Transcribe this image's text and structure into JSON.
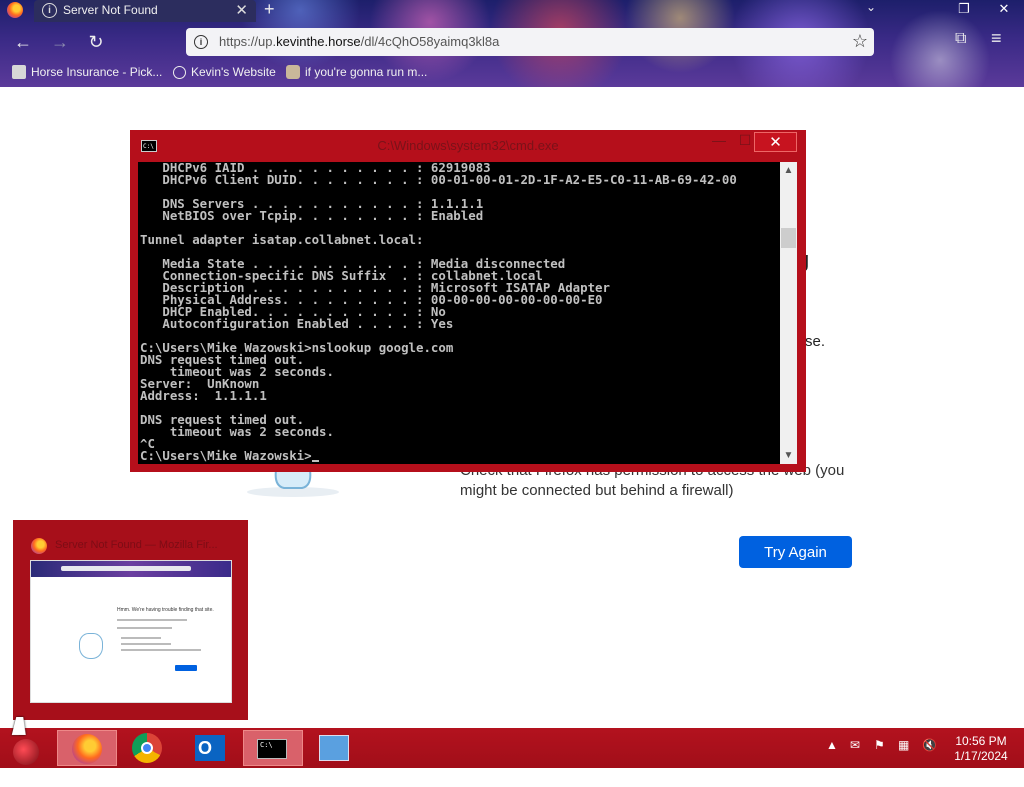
{
  "browser": {
    "tab_title": "Server Not Found",
    "tab_close": "✕",
    "new_tab": "+",
    "url_host_prefix": "https://up.",
    "url_host": "kevinthe.horse",
    "url_path": "/dl/4cQhO58yaimq3kl8a",
    "bookmarks": [
      {
        "label": "Horse Insurance - Pick..."
      },
      {
        "label": "Kevin's Website"
      },
      {
        "label": "if you're gonna run m..."
      }
    ]
  },
  "page": {
    "heading_fragment": "g",
    "text_fragment": "se.",
    "firewall_tip": "Check that Firefox has permission to access the web (you might be connected but behind a firewall)",
    "try_again_label": "Try Again"
  },
  "cmd": {
    "title": "C:\\Windows\\system32\\cmd.exe",
    "lines": [
      "   DHCPv6 IAID . . . . . . . . . . . : 62919083",
      "   DHCPv6 Client DUID. . . . . . . . : 00-01-00-01-2D-1F-A2-E5-C0-11-AB-69-42-00",
      "",
      "   DNS Servers . . . . . . . . . . . : 1.1.1.1",
      "   NetBIOS over Tcpip. . . . . . . . : Enabled",
      "",
      "Tunnel adapter isatap.collabnet.local:",
      "",
      "   Media State . . . . . . . . . . . : Media disconnected",
      "   Connection-specific DNS Suffix  . : collabnet.local",
      "   Description . . . . . . . . . . . : Microsoft ISATAP Adapter",
      "   Physical Address. . . . . . . . . : 00-00-00-00-00-00-00-E0",
      "   DHCP Enabled. . . . . . . . . . . : No",
      "   Autoconfiguration Enabled . . . . : Yes",
      "",
      "C:\\Users\\Mike Wazowski>nslookup google.com",
      "DNS request timed out.",
      "    timeout was 2 seconds.",
      "Server:  UnKnown",
      "Address:  1.1.1.1",
      "",
      "DNS request timed out.",
      "    timeout was 2 seconds.",
      "^C"
    ],
    "prompt": "C:\\Users\\Mike Wazowski>"
  },
  "thumbnail": {
    "title": "Server Not Found — Mozilla Fir...",
    "mini_heading": "Hmm. We're having trouble finding that site."
  },
  "taskbar": {
    "apps": [
      "firefox-icon",
      "chrome-icon",
      "outlook-icon",
      "cmd-icon",
      "control-panel-icon"
    ],
    "clock_time": "10:56 PM",
    "clock_date": "1/17/2024"
  },
  "colors": {
    "taskbar": "#b3121e",
    "cmd_frame": "#b50f1b",
    "try_again": "#0061e0"
  }
}
